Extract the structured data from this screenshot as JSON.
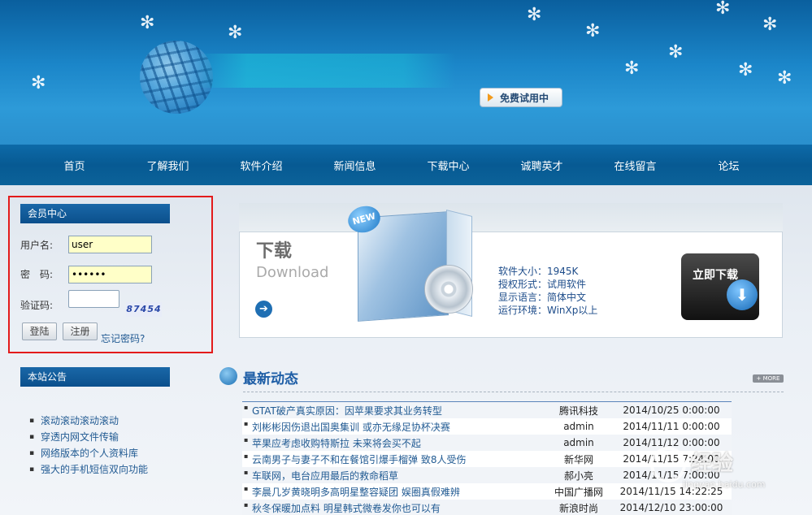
{
  "header": {
    "trial_button": "免费试用中"
  },
  "nav": {
    "items": [
      "首页",
      "了解我们",
      "软件介绍",
      "新闻信息",
      "下载中心",
      "诚聘英才",
      "在线留言",
      "论坛"
    ]
  },
  "member": {
    "title": "会员中心",
    "username_label": "用户名:",
    "username_value": "user",
    "password_label": "密　码:",
    "password_value": "123456",
    "captcha_label": "验证码:",
    "captcha_text": "87454",
    "login_button": "登陆",
    "register_button": "注册",
    "forgot_link": "忘记密码?"
  },
  "notice": {
    "title": "本站公告",
    "items": [
      "滚动滚动滚动滚动",
      "穿透内网文件传输",
      "网络版本的个人资料库",
      "强大的手机短信双向功能"
    ]
  },
  "download": {
    "title": "下载",
    "subtitle": "Download",
    "new_badge": "NEW",
    "info": [
      "软件大小：1945K",
      "授权形式：试用软件",
      "显示语言：简体中文",
      "运行环境：WinXp以上"
    ],
    "button": "立即下载"
  },
  "news": {
    "title": "最新动态",
    "more": "+ MORE",
    "rows": [
      {
        "title": "GTAT破产真实原因：因苹果要求其业务转型",
        "source": "腾讯科技",
        "date": "2014/10/25 0:00:00"
      },
      {
        "title": "刘彬彬因伤退出国奥集训 或亦无缘足协杯决赛",
        "source": "admin",
        "date": "2014/11/11 0:00:00"
      },
      {
        "title": "苹果应考虑收购特斯拉 未来将会买不起",
        "source": "admin",
        "date": "2014/11/12 0:00:00"
      },
      {
        "title": "云南男子与妻子不和在餐馆引爆手榴弹 致8人受伤",
        "source": "新华网",
        "date": "2014/11/15 7:24:00"
      },
      {
        "title": "车联网，电台应用最后的救命稻草",
        "source": "郝小亮",
        "date": "2014/11/15 7:00:00"
      },
      {
        "title": "李晨几岁黄晓明多高明星整容疑团 娱圈真假难辨",
        "source": "中国广播网",
        "date": "2014/11/15 14:22:25"
      },
      {
        "title": "秋冬保暖加点料 明星韩式微卷发你也可以有",
        "source": "新浪时尚",
        "date": "2014/12/10 23:00:00"
      }
    ]
  },
  "watermark": {
    "text": "经验",
    "url": "jingyan.baidu.com"
  }
}
